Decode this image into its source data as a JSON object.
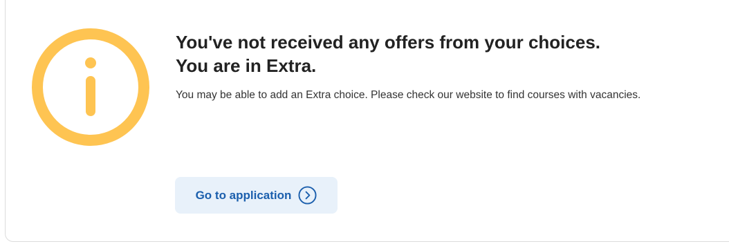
{
  "notice": {
    "heading_line1": "You've not received any offers from your choices.",
    "heading_line2": "You are in Extra.",
    "body": "You may be able to add an Extra choice. Please check our website to find courses with vacancies.",
    "icon": "info-icon",
    "icon_color": "#fec452"
  },
  "actions": {
    "go_to_application_label": "Go to application",
    "go_to_application_icon": "chevron-right-circle-icon",
    "accent_color": "#1b5fad",
    "button_background": "#e8f1fa"
  }
}
